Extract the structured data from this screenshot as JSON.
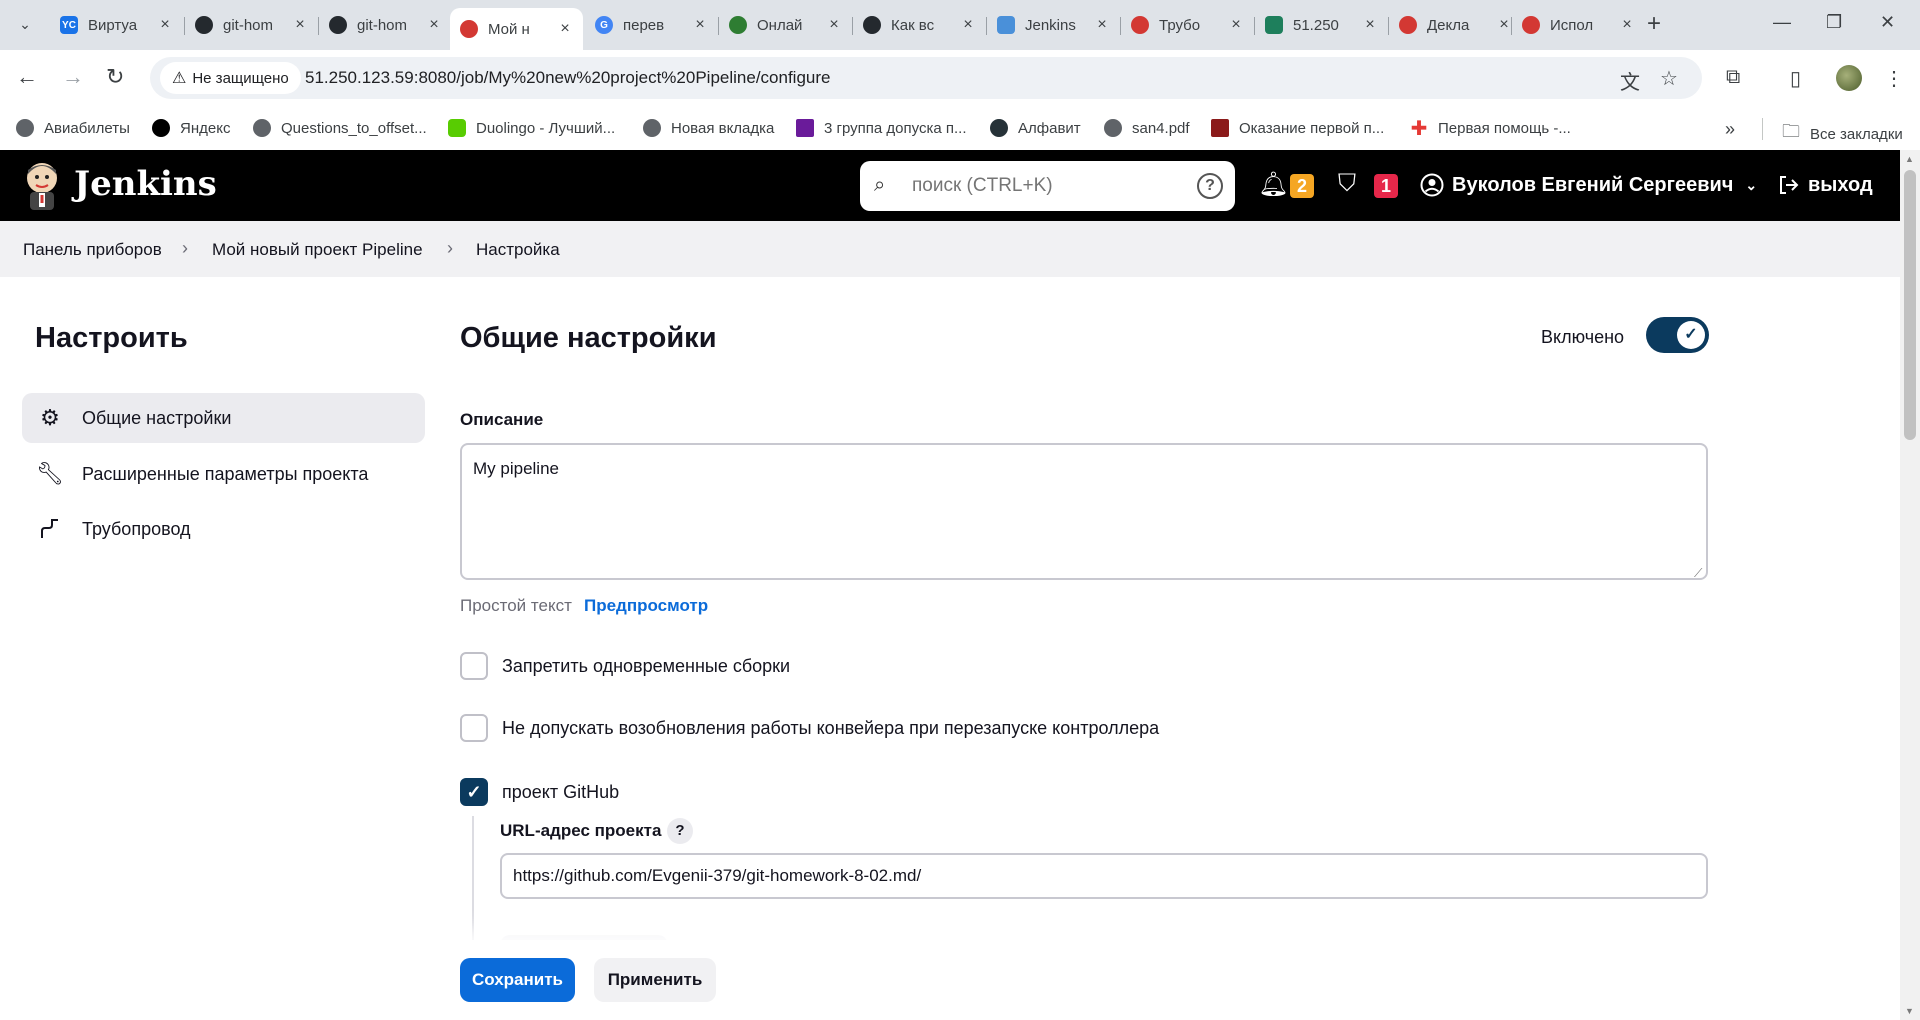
{
  "browser": {
    "tabs": [
      {
        "title": "Виртуа",
        "icon": "yandex-cloud-icon",
        "color": "#1a73e8"
      },
      {
        "title": "git-hom",
        "icon": "github-icon",
        "color": "#24292e"
      },
      {
        "title": "git-hom",
        "icon": "github-icon",
        "color": "#24292e"
      },
      {
        "title": "Мой н",
        "icon": "jenkins-icon",
        "color": "#d33833",
        "active": true
      },
      {
        "title": "перев",
        "icon": "google-icon",
        "color": "#4285f4"
      },
      {
        "title": "Онлай",
        "icon": "web-icon",
        "color": "#2e7d32"
      },
      {
        "title": "Как вс",
        "icon": "github-icon",
        "color": "#24292e"
      },
      {
        "title": "Jenkins",
        "icon": "jenkins-blue-icon",
        "color": "#4a90d9"
      },
      {
        "title": "Трубо",
        "icon": "jenkins-icon",
        "color": "#d33833"
      },
      {
        "title": "51.250",
        "icon": "layers-icon",
        "color": "#1e7f5c"
      },
      {
        "title": "Декла",
        "icon": "jenkins-icon",
        "color": "#d33833"
      },
      {
        "title": "Испол",
        "icon": "jenkins-icon",
        "color": "#d33833"
      }
    ],
    "security_chip": "Не защищено",
    "url": "51.250.123.59:8080/job/My%20new%20project%20Pipeline/configure",
    "bookmarks": [
      {
        "label": "Авиабилеты",
        "icon": "globe-icon"
      },
      {
        "label": "Яндекс",
        "icon": "yandex-icon"
      },
      {
        "label": "Questions_to_offset...",
        "icon": "globe-icon"
      },
      {
        "label": "Duolingo - Лучший...",
        "icon": "duolingo-icon"
      },
      {
        "label": "Новая вкладка",
        "icon": "globe-icon"
      },
      {
        "label": "3 группа допуска п...",
        "icon": "bolt-icon"
      },
      {
        "label": "Алфавит",
        "icon": "eye-icon"
      },
      {
        "label": "san4.pdf",
        "icon": "globe-icon"
      },
      {
        "label": "Оказание первой п...",
        "icon": "pdf-icon"
      },
      {
        "label": "Первая помощь -...",
        "icon": "red-cross-icon"
      }
    ],
    "all_bookmarks": "Все закладки"
  },
  "jenkins": {
    "title": "Jenkins",
    "search_placeholder": "поиск (CTRL+K)",
    "notifications_count": "2",
    "security_count": "1",
    "user_name": "Вуколов Евгений Сергеевич",
    "logout": "выход"
  },
  "breadcrumb": [
    "Панель приборов",
    "Мой новый проект Pipeline",
    "Настройка"
  ],
  "sidebar": {
    "title": "Настроить",
    "items": [
      {
        "label": "Общие настройки",
        "icon": "gear-icon",
        "active": true
      },
      {
        "label": "Расширенные параметры проекта",
        "icon": "wrench-icon"
      },
      {
        "label": "Трубопровод",
        "icon": "pipeline-icon"
      }
    ]
  },
  "main": {
    "title": "Общие настройки",
    "enabled_label": "Включено",
    "enabled": true,
    "description_label": "Описание",
    "description_value": "My pipeline",
    "format_plain": "Простой текст",
    "format_preview": "Предпросмотр",
    "checkboxes": [
      {
        "label": "Запретить одновременные сборки",
        "checked": false
      },
      {
        "label": "Не допускать возобновления работы конвейера при перезапуске контроллера",
        "checked": false
      },
      {
        "label": "проект GitHub",
        "checked": true
      }
    ],
    "project_url_label": "URL-адрес проекта",
    "project_url_value": "https://github.com/Evgenii-379/git-homework-8-02.md/"
  },
  "actions": {
    "save": "Сохранить",
    "apply": "Применить"
  }
}
